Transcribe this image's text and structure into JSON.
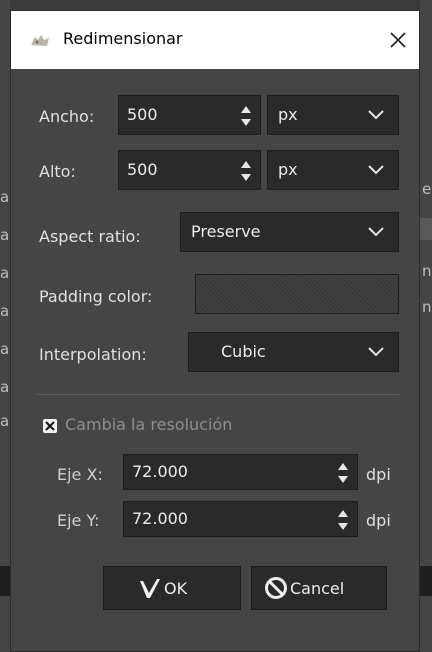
{
  "background": {
    "left_letters": [
      "a",
      "a",
      "a",
      "a",
      "a",
      "a",
      "a",
      "a",
      "a",
      "a",
      "a"
    ],
    "right_letters": [
      "e",
      "n",
      "n"
    ]
  },
  "dialog": {
    "title": "Redimensionar",
    "app_icon": "gimp-icon",
    "close_icon": "close-icon"
  },
  "width": {
    "label": "Ancho:",
    "value": "500",
    "unit": "px"
  },
  "height": {
    "label": "Alto:",
    "value": "500",
    "unit": "px"
  },
  "aspect_ratio": {
    "label": "Aspect ratio:",
    "value": "Preserve"
  },
  "padding_color": {
    "label": "Padding color:"
  },
  "interpolation": {
    "label": "Interpolation:",
    "value": "Cubic"
  },
  "resolution": {
    "checkbox_label": "Cambia la resolución",
    "checked": true,
    "x": {
      "label": "Eje X:",
      "value": "72.000",
      "unit": "dpi"
    },
    "y": {
      "label": "Eje Y:",
      "value": "72.000",
      "unit": "dpi"
    }
  },
  "buttons": {
    "ok": "OK",
    "cancel": "Cancel"
  }
}
